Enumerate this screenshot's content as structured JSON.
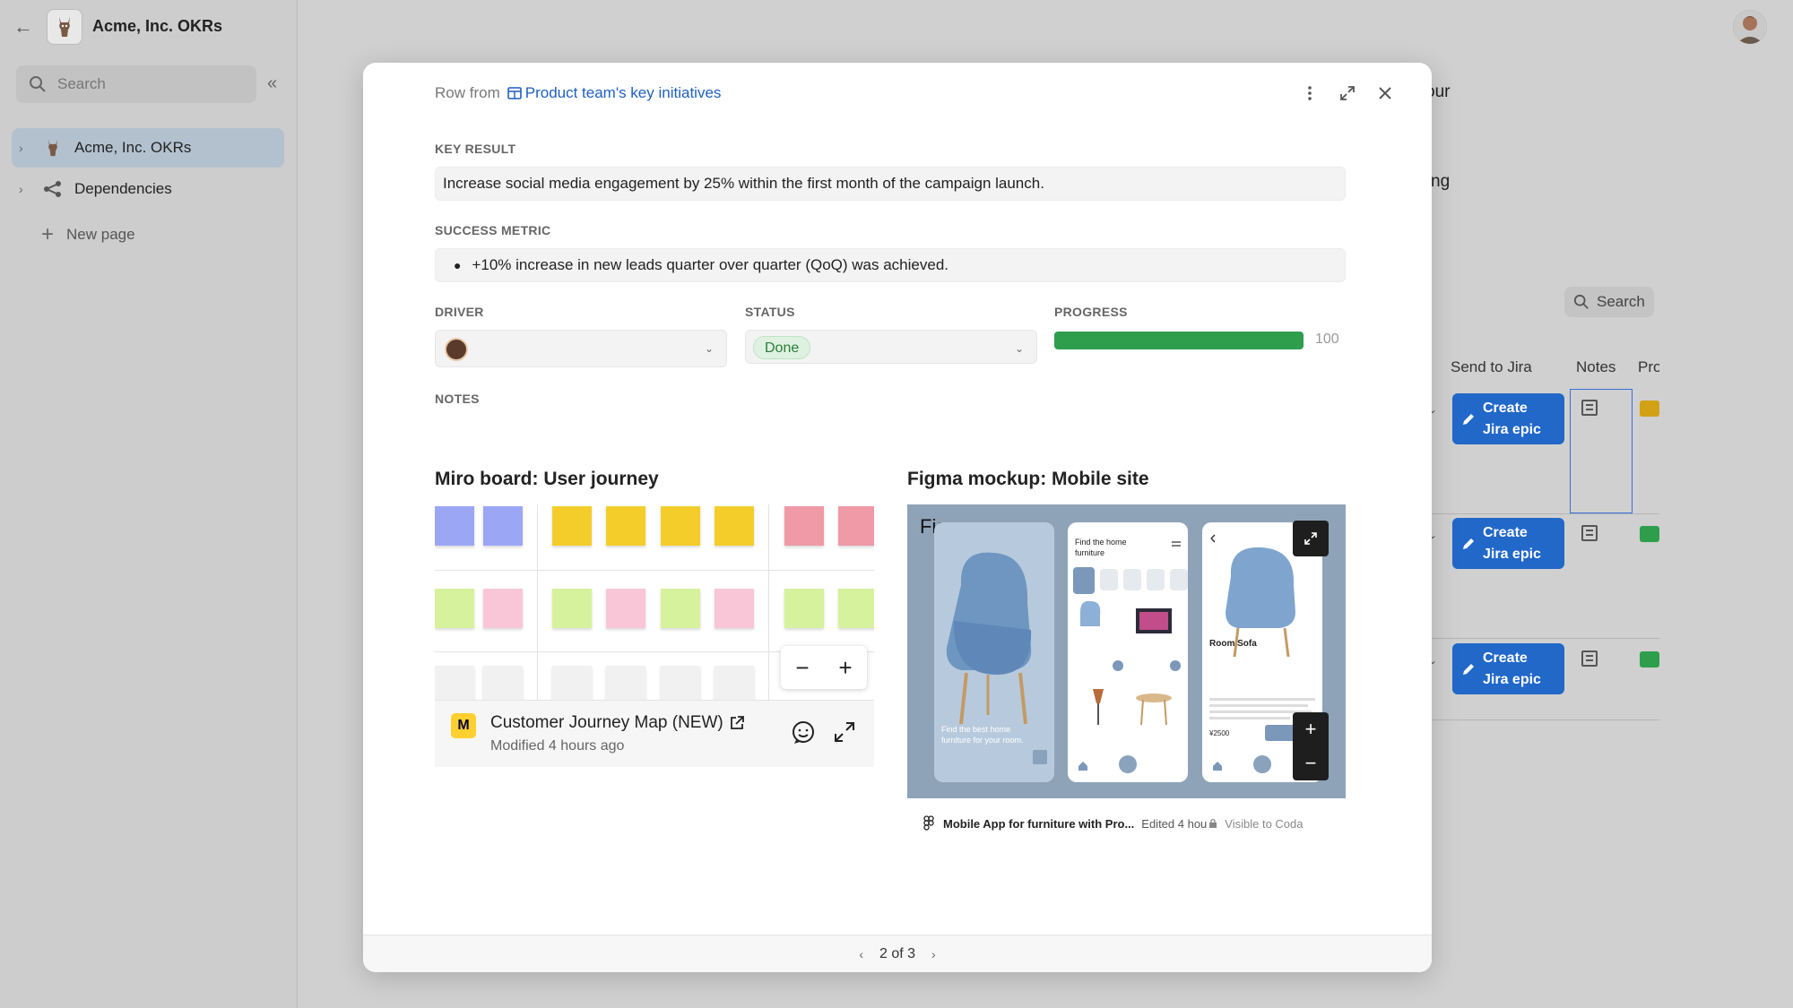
{
  "sidebar": {
    "doc_title": "Acme, Inc. OKRs",
    "search_placeholder": "Search",
    "items": [
      {
        "label": "Acme, Inc. OKRs"
      },
      {
        "label": "Dependencies"
      }
    ],
    "new_page_label": "New page"
  },
  "background": {
    "fragment_1": "our",
    "fragment_2": "ng",
    "search_label": "Search",
    "columns": {
      "send_to_jira": "Send to Jira",
      "notes": "Notes",
      "progress": "Pro"
    },
    "jira_button_line1": "Create",
    "jira_button_line2": "Jira epic",
    "chip_colors": [
      "#d3a114",
      "#2e9e4c",
      "#2e9e4c"
    ]
  },
  "modal": {
    "source_prefix": "Row from",
    "source_table": "Product team's key initiatives",
    "key_result_label": "KEY RESULT",
    "key_result_value": "Increase social media engagement by 25% within the first month of the campaign launch.",
    "success_metric_label": "SUCCESS METRIC",
    "success_metric_value": "+10% increase in new leads quarter over quarter (QoQ) was achieved.",
    "driver_label": "DRIVER",
    "status_label": "STATUS",
    "status_value": "Done",
    "progress_label": "PROGRESS",
    "progress_value": "100",
    "progress_fraction": 1.0,
    "notes_label": "NOTES",
    "miro": {
      "title": "Miro board: User journey",
      "board_name": "Customer Journey Map (NEW)",
      "modified": "Modified 4 hours ago"
    },
    "figma": {
      "title": "Figma mockup: Mobile site",
      "canvas_word": "Figma",
      "file_name": "Mobile App for furniture with Pro...",
      "edited": "Edited 4 hou",
      "visibility": "Visible to Coda",
      "phone1_text": "Find the best home furniture for your room.",
      "phone2_title": "Find the home furniture",
      "phone3_title": "Room Sofa",
      "phone3_price": "¥2500"
    },
    "pagination": "2 of 3"
  },
  "colors": {
    "accent": "#1d5fbf",
    "jira_button": "#2168c8",
    "progress": "#2e9e4c",
    "status_done_bg": "#dff2e1"
  }
}
